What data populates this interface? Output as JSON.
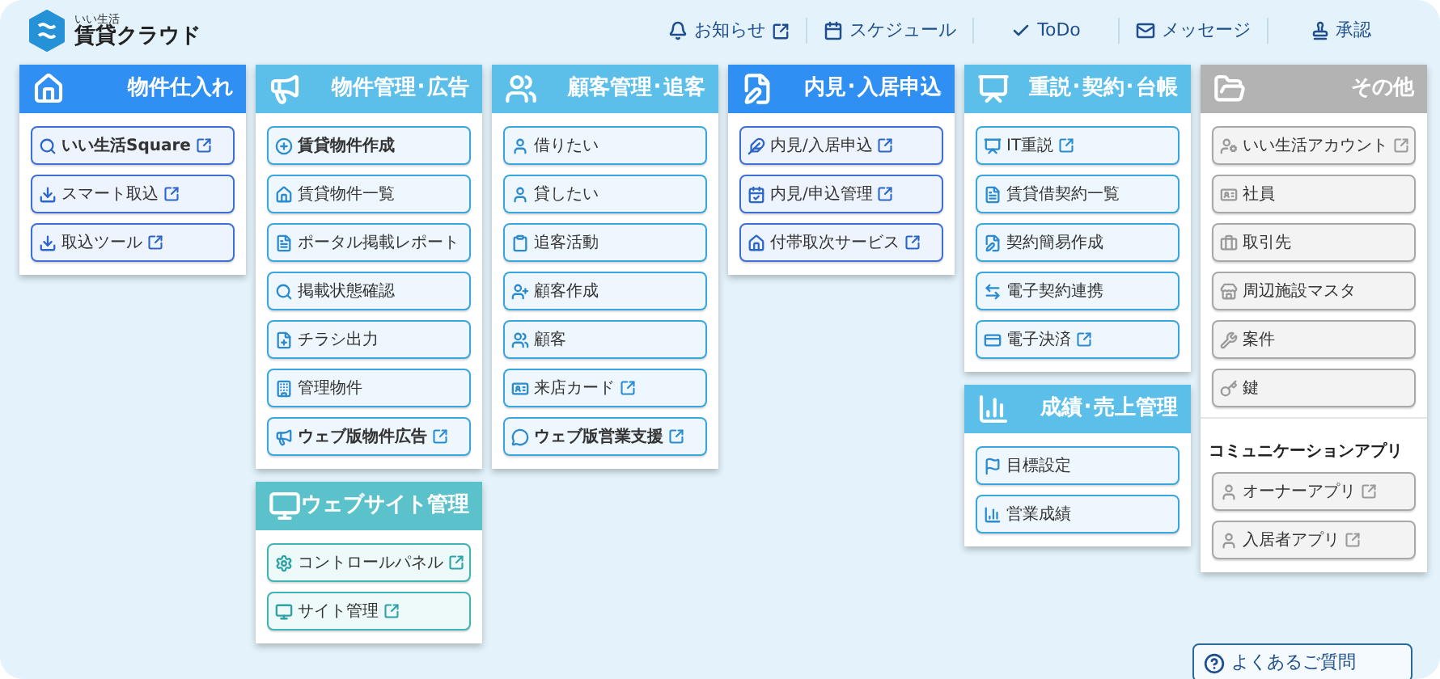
{
  "logo": {
    "tagline": "いい生活",
    "name": "賃貸クラウド"
  },
  "nav": [
    {
      "label": "お知らせ",
      "external": true
    },
    {
      "label": "スケジュール",
      "external": false
    },
    {
      "label": "ToDo",
      "external": false
    },
    {
      "label": "メッセージ",
      "external": false
    },
    {
      "label": "承認",
      "external": false
    }
  ],
  "columns": [
    {
      "panels": [
        {
          "title": "物件仕入れ",
          "kind": "blue",
          "items": [
            {
              "kind": "link",
              "label": "いい生活Square",
              "bold": true,
              "external": true
            },
            {
              "kind": "link",
              "label": "スマート取込",
              "bold": false,
              "external": true
            },
            {
              "kind": "link",
              "label": "取込ツール",
              "bold": false,
              "external": true
            }
          ]
        }
      ]
    },
    {
      "panels": [
        {
          "title": "物件管理･広告",
          "kind": "sky",
          "items": [
            {
              "kind": "link",
              "label": "賃貸物件作成",
              "bold": true,
              "external": false
            },
            {
              "kind": "link",
              "label": "賃貸物件一覧",
              "bold": false,
              "external": false
            },
            {
              "kind": "link",
              "label": "ポータル掲載レポート",
              "bold": false,
              "external": false
            },
            {
              "kind": "link",
              "label": "掲載状態確認",
              "bold": false,
              "external": false
            },
            {
              "kind": "link",
              "label": "チラシ出力",
              "bold": false,
              "external": false
            },
            {
              "kind": "link",
              "label": "管理物件",
              "bold": false,
              "external": false
            },
            {
              "kind": "link",
              "label": "ウェブ版物件広告",
              "bold": true,
              "external": true
            }
          ]
        },
        {
          "title": "ウェブサイト管理",
          "kind": "teal",
          "items": [
            {
              "kind": "link",
              "label": "コントロールパネル",
              "bold": false,
              "external": true
            },
            {
              "kind": "link",
              "label": "サイト管理",
              "bold": false,
              "external": true
            }
          ]
        }
      ]
    },
    {
      "panels": [
        {
          "title": "顧客管理･追客",
          "kind": "sky",
          "items": [
            {
              "kind": "link",
              "label": "借りたい",
              "bold": false,
              "external": false
            },
            {
              "kind": "link",
              "label": "貸したい",
              "bold": false,
              "external": false
            },
            {
              "kind": "link",
              "label": "追客活動",
              "bold": false,
              "external": false
            },
            {
              "kind": "link",
              "label": "顧客作成",
              "bold": false,
              "external": false
            },
            {
              "kind": "link",
              "label": "顧客",
              "bold": false,
              "external": false
            },
            {
              "kind": "link",
              "label": "来店カード",
              "bold": false,
              "external": true
            },
            {
              "kind": "link",
              "label": "ウェブ版営業支援",
              "bold": true,
              "external": true
            }
          ]
        }
      ]
    },
    {
      "panels": [
        {
          "title": "内見･入居申込",
          "kind": "blue",
          "items": [
            {
              "kind": "link",
              "label": "内見/入居申込",
              "bold": false,
              "external": true
            },
            {
              "kind": "link",
              "label": "内見/申込管理",
              "bold": false,
              "external": true
            },
            {
              "kind": "link",
              "label": "付帯取次サービス",
              "bold": false,
              "external": true
            }
          ]
        }
      ]
    },
    {
      "panels": [
        {
          "title": "重説･契約･台帳",
          "kind": "sky",
          "items": [
            {
              "kind": "link",
              "label": "IT重説",
              "bold": false,
              "external": true
            },
            {
              "kind": "link",
              "label": "賃貸借契約一覧",
              "bold": false,
              "external": false
            },
            {
              "kind": "link",
              "label": "契約簡易作成",
              "bold": false,
              "external": false
            },
            {
              "kind": "link",
              "label": "電子契約連携",
              "bold": false,
              "external": false
            },
            {
              "kind": "link",
              "label": "電子決済",
              "bold": false,
              "external": true
            }
          ]
        },
        {
          "title": "成績･売上管理",
          "kind": "sky",
          "items": [
            {
              "kind": "link",
              "label": "目標設定",
              "bold": false,
              "external": false
            },
            {
              "kind": "link",
              "label": "営業成績",
              "bold": false,
              "external": false
            }
          ]
        }
      ]
    },
    {
      "panels": [
        {
          "title": "その他",
          "kind": "gray",
          "items": [
            {
              "kind": "link",
              "label": "いい生活アカウント",
              "bold": false,
              "external": true
            },
            {
              "kind": "link",
              "label": "社員",
              "bold": false,
              "external": false
            },
            {
              "kind": "link",
              "label": "取引先",
              "bold": false,
              "external": false
            },
            {
              "kind": "link",
              "label": "周辺施設マスタ",
              "bold": false,
              "external": false
            },
            {
              "kind": "link",
              "label": "案件",
              "bold": false,
              "external": false
            },
            {
              "kind": "link",
              "label": "鍵",
              "bold": false,
              "external": false
            },
            {
              "kind": "heading",
              "label": "コミュニケーションアプリ"
            },
            {
              "kind": "link",
              "label": "オーナーアプリ",
              "bold": false,
              "external": true
            },
            {
              "kind": "link",
              "label": "入居者アプリ",
              "bold": false,
              "external": true
            }
          ]
        }
      ]
    }
  ],
  "faq": {
    "label": "よくあるご質問"
  }
}
